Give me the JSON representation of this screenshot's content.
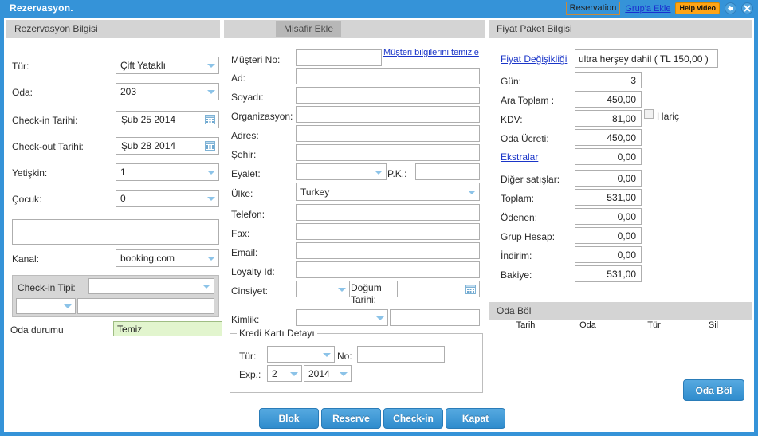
{
  "window": {
    "title": "Rezervasyon.",
    "reservation_badge": "Reservation",
    "group_link": "Grup'a Ekle",
    "help_button": "Help video",
    "refresh_icon": "refresh-icon",
    "close_icon": "close-icon"
  },
  "left_panel": {
    "header": "Rezervasyon Bilgisi",
    "fields": [
      {
        "label": "Tür:",
        "value": "Çift Yataklı",
        "type": "combo"
      },
      {
        "label": "Oda:",
        "value": "203",
        "type": "combo"
      },
      {
        "label": "Check-in Tarihi:",
        "value": "Şub 25 2014",
        "type": "date"
      },
      {
        "label": "Check-out Tarihi:",
        "value": "Şub 28 2014",
        "type": "date"
      },
      {
        "label": "Yetişkin:",
        "value": "1",
        "type": "combo"
      },
      {
        "label": "Çocuk:",
        "value": "0",
        "type": "combo"
      }
    ],
    "notes_value": "",
    "kanal_label": "Kanal:",
    "kanal_value": "booking.com",
    "checkin_tipi_label": "Check-in Tipi:",
    "checkin_tipi_value": "",
    "checkin_sub_combo_value": "",
    "checkin_sub_text_value": "",
    "oda_durumu_label": "Oda durumu",
    "oda_durumu_value": "Temiz"
  },
  "middle_panel": {
    "tab_label": "Misafir Ekle",
    "clear_link": "Müşteri bilgilerini temizle",
    "fields": [
      {
        "label": "Müşteri No:",
        "value": "",
        "type": "text"
      },
      {
        "label": "Ad:",
        "value": "",
        "type": "text"
      },
      {
        "label": "Soyadı:",
        "value": "",
        "type": "text"
      },
      {
        "label": "Organizasyon:",
        "value": "",
        "type": "text"
      },
      {
        "label": "Adres:",
        "value": "",
        "type": "text"
      },
      {
        "label": "Şehir:",
        "value": "",
        "type": "text"
      }
    ],
    "eyalet_label": "Eyalet:",
    "eyalet_value": "",
    "pk_label": "P.K.:",
    "pk_value": "",
    "ulke_label": "Ülke:",
    "ulke_value": "Turkey",
    "telefon_label": "Telefon:",
    "telefon_value": "",
    "fax_label": "Fax:",
    "fax_value": "",
    "email_label": "Email:",
    "email_value": "",
    "loyalty_label": "Loyalty Id:",
    "loyalty_value": "",
    "cinsiyet_label": "Cinsiyet:",
    "cinsiyet_value": "",
    "dogum_label_line1": "Doğum",
    "dogum_label_line2": "Tarihi:",
    "dogum_value": "",
    "kimlik_label": "Kimlik:",
    "kimlik_combo_value": "",
    "kimlik_text_value": "",
    "credit_card": {
      "legend": "Kredi Kartı Detayı",
      "tur_label": "Tür:",
      "tur_value": "",
      "no_label": "No:",
      "no_value": "",
      "exp_label": "Exp.:",
      "exp_month": "2",
      "exp_year": "2014"
    }
  },
  "right_panel": {
    "header": "Fiyat Paket Bilgisi",
    "price_change_link": "Fiyat Değişikliği",
    "package_value": "ultra herşey dahil ( TL 150,00 )",
    "rows": [
      {
        "label": "Gün:",
        "value": "3"
      },
      {
        "label": "Ara Toplam :",
        "value": "450,00"
      },
      {
        "label": "KDV:",
        "value": "81,00"
      },
      {
        "label": "Oda Ücreti:",
        "value": "450,00"
      },
      {
        "label": "Ekstralar",
        "value": "0,00"
      },
      {
        "label": "Diğer satışlar:",
        "value": "0,00"
      },
      {
        "label": "Toplam:",
        "value": "531,00"
      },
      {
        "label": "Ödenen:",
        "value": "0,00"
      },
      {
        "label": "Grup Hesap:",
        "value": "0,00"
      },
      {
        "label": "İndirim:",
        "value": "0,00"
      },
      {
        "label": "Bakiye:",
        "value": "531,00"
      }
    ],
    "hariç_label": "Hariç",
    "ekstralar_link": "Ekstralar",
    "split": {
      "header": "Oda Böl",
      "columns": [
        "Tarih",
        "Oda",
        "Tür",
        "Sil"
      ],
      "rows": [],
      "button": "Oda Böl"
    }
  },
  "footer": {
    "buttons": [
      "Blok",
      "Reserve",
      "Check-in",
      "Kapat"
    ]
  },
  "colors": {
    "accent": "#3593d8",
    "panel_header": "#d4d4d4",
    "link": "#1a35c8",
    "help": "#ffa416",
    "status_green": "#e2f5ce"
  }
}
